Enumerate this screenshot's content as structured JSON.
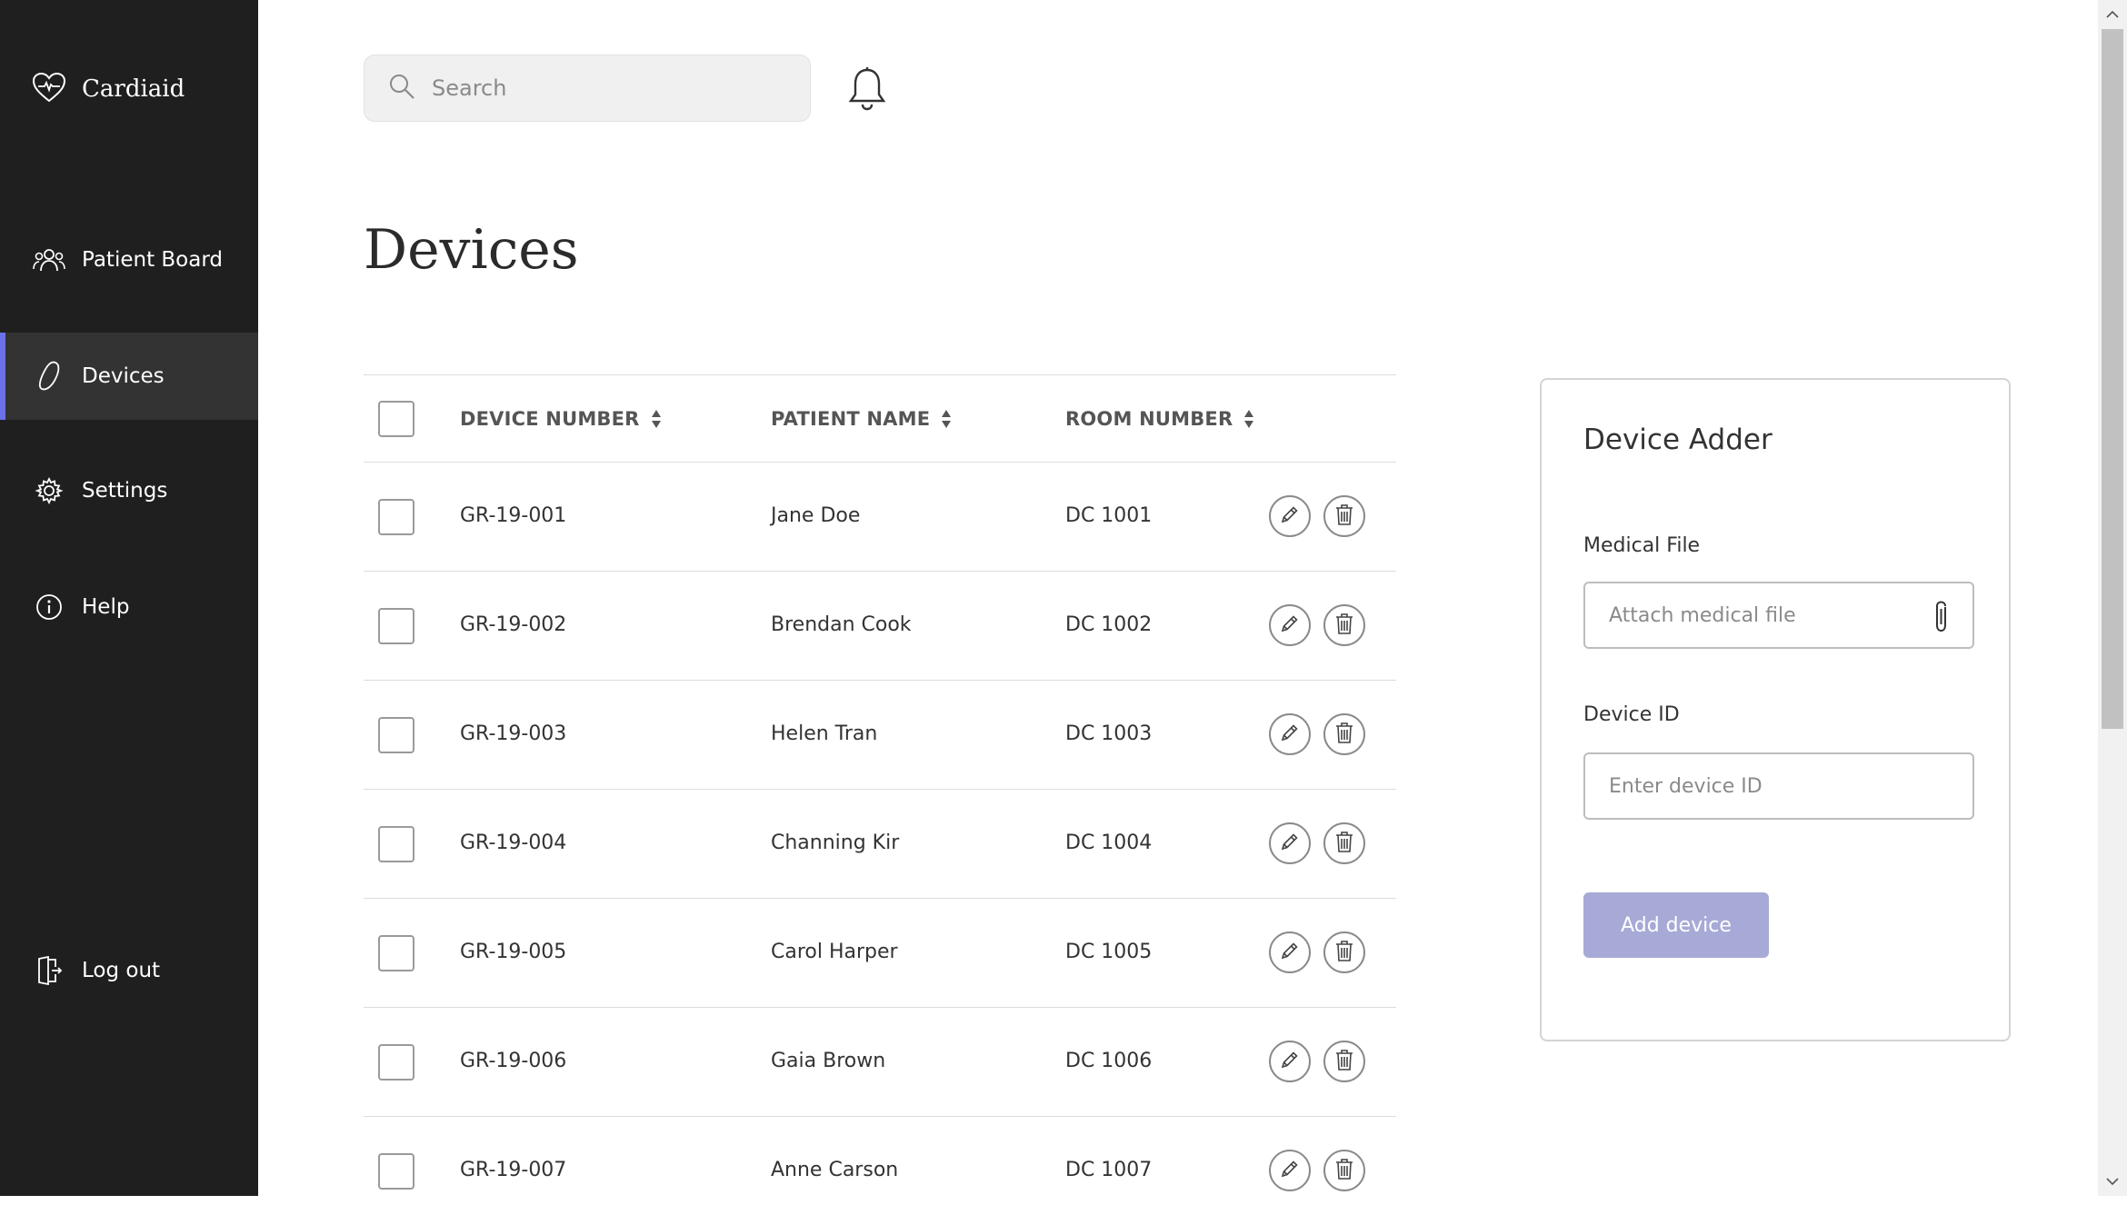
{
  "brand": {
    "name": "Cardiaid"
  },
  "sidebar": {
    "items": [
      {
        "label": "Patient Board",
        "icon": "people-icon"
      },
      {
        "label": "Devices",
        "icon": "device-icon",
        "active": true
      },
      {
        "label": "Settings",
        "icon": "gear-icon"
      },
      {
        "label": "Help",
        "icon": "info-icon"
      }
    ],
    "logout": {
      "label": "Log out",
      "icon": "logout-icon"
    },
    "accent_color": "#6b72e8"
  },
  "search": {
    "placeholder": "Search",
    "value": ""
  },
  "page": {
    "title": "Devices"
  },
  "table": {
    "columns": [
      "DEVICE NUMBER",
      "PATIENT NAME",
      "ROOM NUMBER"
    ],
    "rows": [
      {
        "device": "GR-19-001",
        "patient": "Jane Doe",
        "room": "DC 1001"
      },
      {
        "device": "GR-19-002",
        "patient": "Brendan Cook",
        "room": "DC 1002"
      },
      {
        "device": "GR-19-003",
        "patient": "Helen Tran",
        "room": "DC 1003"
      },
      {
        "device": "GR-19-004",
        "patient": "Channing Kir",
        "room": "DC 1004"
      },
      {
        "device": "GR-19-005",
        "patient": "Carol Harper",
        "room": "DC 1005"
      },
      {
        "device": "GR-19-006",
        "patient": "Gaia Brown",
        "room": "DC 1006"
      },
      {
        "device": "GR-19-007",
        "patient": "Anne Carson",
        "room": "DC 1007"
      }
    ]
  },
  "adder": {
    "title": "Device Adder",
    "medical_label": "Medical File",
    "medical_placeholder": "Attach medical file",
    "device_label": "Device ID",
    "device_placeholder": "Enter device ID",
    "button_label": "Add device",
    "button_color": "#a7aad6"
  }
}
